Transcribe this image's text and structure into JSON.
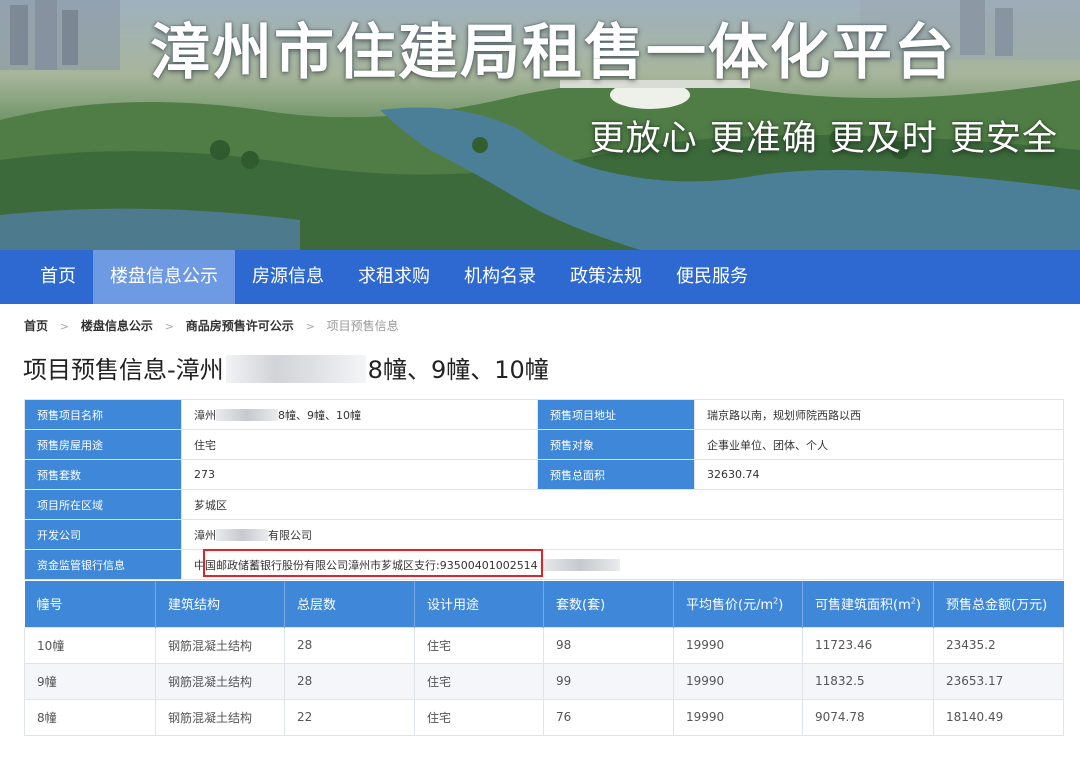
{
  "banner": {
    "title": "漳州市住建局租售一体化平台",
    "slogan": "更放心  更准确  更及时  更安全"
  },
  "nav": {
    "items": [
      {
        "label": "首页",
        "active": false
      },
      {
        "label": "楼盘信息公示",
        "active": true
      },
      {
        "label": "房源信息",
        "active": false
      },
      {
        "label": "求租求购",
        "active": false
      },
      {
        "label": "机构名录",
        "active": false
      },
      {
        "label": "政策法规",
        "active": false
      },
      {
        "label": "便民服务",
        "active": false
      }
    ]
  },
  "breadcrumb": {
    "home": "首页",
    "level1": "楼盘信息公示",
    "level2": "商品房预售许可公示",
    "current": "项目预售信息"
  },
  "page_title": {
    "prefix": "项目预售信息-漳州",
    "suffix": "8幢、9幢、10幢"
  },
  "info": {
    "project_name_label": "预售项目名称",
    "project_name_prefix": "漳州",
    "project_name_suffix": "8幢、9幢、10幢",
    "project_address_label": "预售项目地址",
    "project_address": "瑞京路以南，规划师院西路以西",
    "usage_label": "预售房屋用途",
    "usage": "住宅",
    "target_label": "预售对象",
    "target": "企事业单位、团体、个人",
    "units_label": "预售套数",
    "units": "273",
    "area_label": "预售总面积",
    "area": "32630.74",
    "district_label": "项目所在区域",
    "district": "芗城区",
    "developer_label": "开发公司",
    "developer_prefix": "漳州",
    "developer_suffix": "有限公司",
    "bank_label": "资金监管银行信息",
    "bank": "中国邮政储蓄银行股份有限公司漳州市芗城区支行:93500401002514"
  },
  "buildings": {
    "headers": {
      "no": "幢号",
      "structure": "建筑结构",
      "floors": "总层数",
      "usage": "设计用途",
      "units": "套数(套)",
      "avg_price": "平均售价(元/m",
      "avg_price_sup": "2",
      "avg_price_close": ")",
      "area": "可售建筑面积(m",
      "area_sup": "2",
      "area_close": ")",
      "total": "预售总金额(万元)"
    },
    "rows": [
      {
        "no": "10幢",
        "structure": "钢筋混凝土结构",
        "floors": "28",
        "usage": "住宅",
        "units": "98",
        "avg_price": "19990",
        "area": "11723.46",
        "total": "23435.2"
      },
      {
        "no": "9幢",
        "structure": "钢筋混凝土结构",
        "floors": "28",
        "usage": "住宅",
        "units": "99",
        "avg_price": "19990",
        "area": "11832.5",
        "total": "23653.17"
      },
      {
        "no": "8幢",
        "structure": "钢筋混凝土结构",
        "floors": "22",
        "usage": "住宅",
        "units": "76",
        "avg_price": "19990",
        "area": "9074.78",
        "total": "18140.49"
      }
    ]
  }
}
